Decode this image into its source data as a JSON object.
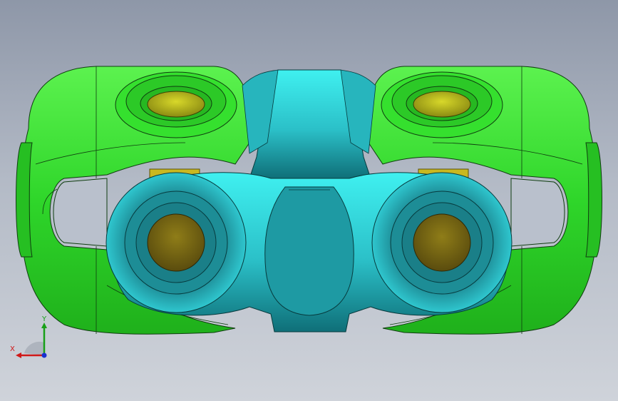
{
  "viewport": {
    "background_top": "#8e97a8",
    "background_bottom": "#cfd3da"
  },
  "model": {
    "colors": {
      "yoke": "#2fd62a",
      "yoke_dark": "#22a81f",
      "spider": "#2fcfd6",
      "spider_dark": "#1b8f96",
      "pin": "#b8b81a",
      "pin_dark": "#7d7d10",
      "edge": "#1a3a1a"
    }
  },
  "triad": {
    "x_label": "X",
    "y_label": "Y",
    "x_color": "#d01818",
    "y_color": "#18a018",
    "z_color": "#1830d0"
  }
}
